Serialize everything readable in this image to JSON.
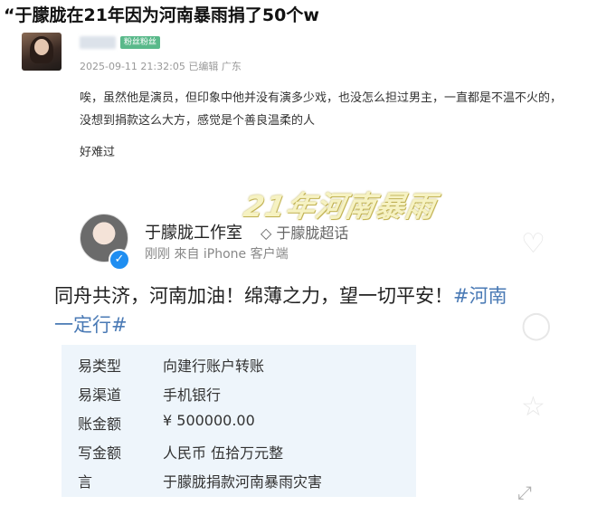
{
  "headline": "“于朦胧在21年因为河南暴雨捐了50个w",
  "post": {
    "badge": "粉丝粉丝",
    "meta": "2025-09-11 21:32:05 已编辑 广东",
    "text": "唉，虽然他是演员，但印象中他并没有演多少戏，也没怎么担过男主，一直都是不温不火的，没想到捐款这么大方，感觉是个善良温柔的人",
    "text2": "好难过"
  },
  "screenshot": {
    "overlay_title": "21年河南暴雨",
    "account_name": "于朦胧工作室",
    "supertopic": "◇ 于朦胧超话",
    "source": "刚刚  來自 iPhone 客户端",
    "verified_mark": "✓",
    "message_line1": "同舟共济，河南加油！绵薄之力，望一切平安！",
    "message_tag1": "#河南",
    "message_line2": "一定行#",
    "transfer": [
      {
        "label": "易类型",
        "value": "向建行账户转账"
      },
      {
        "label": "易渠道",
        "value": "手机银行"
      },
      {
        "label": "账金额",
        "value": "¥ 500000.00"
      },
      {
        "label": "写金额",
        "value": "人民币 伍拾万元整"
      },
      {
        "label": "言",
        "value": "于朦胧捐款河南暴雨灾害"
      }
    ]
  },
  "icons": {
    "like": "heart-icon",
    "comment": "comment-icon",
    "share": "share-icon",
    "expand": "expand-icon"
  },
  "colors": {
    "badge": "#59b98a",
    "verified": "#1f8ef1",
    "table_bg": "#eef5fb",
    "hashtag": "#4a7ab5"
  }
}
